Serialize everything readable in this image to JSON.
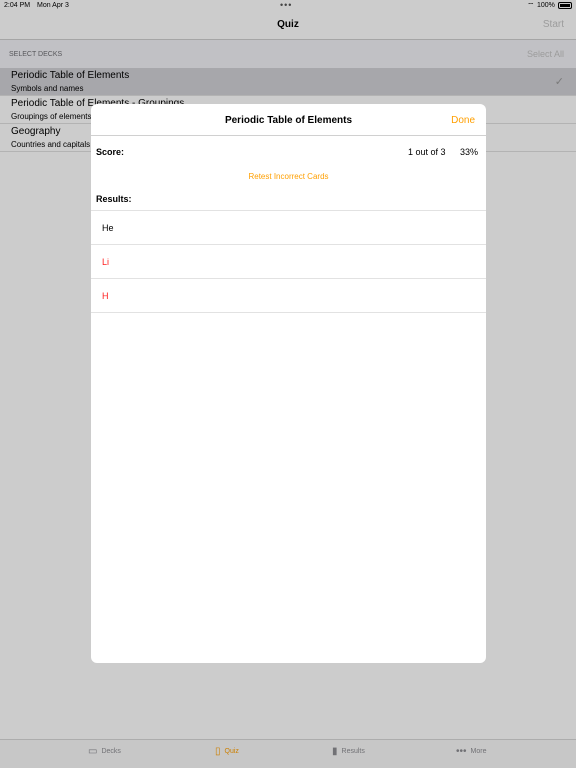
{
  "status_bar": {
    "time": "2:04 PM",
    "date": "Mon Apr 3",
    "battery": "100%"
  },
  "nav": {
    "title": "Quiz",
    "start_label": "Start"
  },
  "decks_section": {
    "header": "SELECT DECKS",
    "select_all_label": "Select All",
    "items": [
      {
        "title": "Periodic Table of Elements",
        "subtitle": "Symbols and names",
        "selected": true
      },
      {
        "title": "Periodic Table of Elements - Groupings",
        "subtitle": "Groupings of elements",
        "selected": false
      },
      {
        "title": "Geography",
        "subtitle": "Countries and capitals",
        "selected": false
      }
    ]
  },
  "modal": {
    "title": "Periodic Table of Elements",
    "done_label": "Done",
    "score_label": "Score:",
    "score_count": "1 out of 3",
    "score_percent": "33%",
    "retest_label": "Retest Incorrect Cards",
    "results_label": "Results:",
    "results": [
      {
        "text": "He",
        "correct": true
      },
      {
        "text": "Li",
        "correct": false
      },
      {
        "text": "H",
        "correct": false
      }
    ]
  },
  "tab_bar": {
    "tabs": [
      {
        "label": "Decks",
        "icon": "decks-icon",
        "active": false
      },
      {
        "label": "Quiz",
        "icon": "quiz-icon",
        "active": true
      },
      {
        "label": "Results",
        "icon": "results-icon",
        "active": false
      },
      {
        "label": "More",
        "icon": "more-icon",
        "active": false
      }
    ]
  },
  "colors": {
    "accent": "#ff9f00",
    "incorrect": "#ff1e1e",
    "disabled": "#c4c4c4"
  }
}
